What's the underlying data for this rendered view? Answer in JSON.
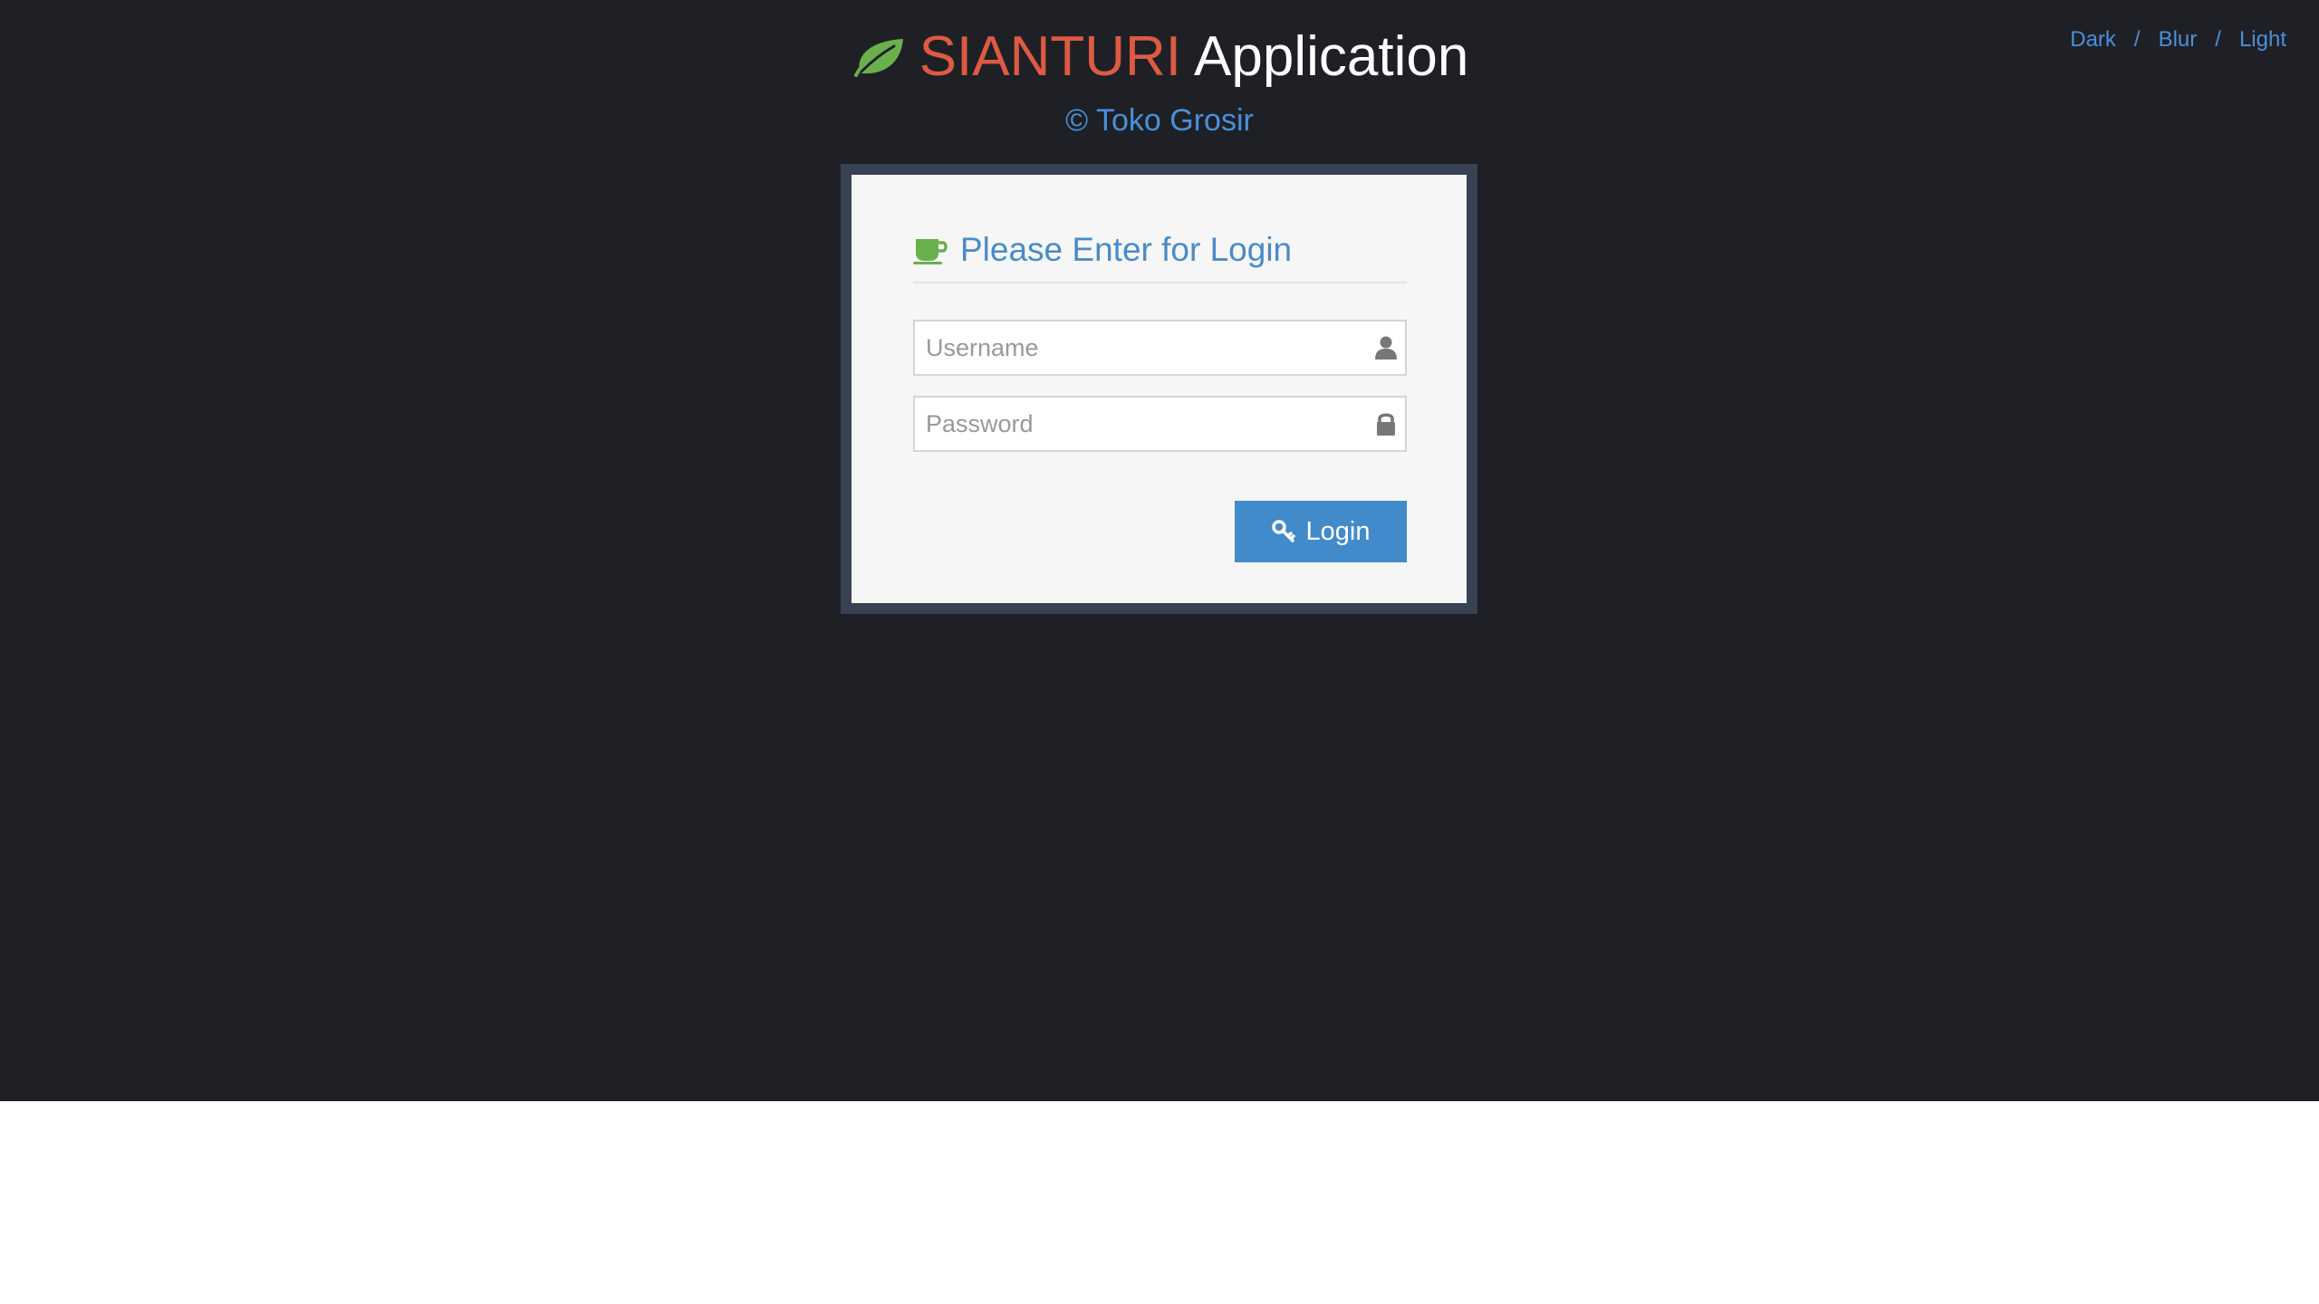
{
  "theme_switch": {
    "items": [
      "Dark",
      "Blur",
      "Light"
    ],
    "separator": "/"
  },
  "brand": {
    "name": "SIANTURI",
    "app_word": "Application",
    "subtitle": "© Toko Grosir",
    "logo_icon": "leaf-icon",
    "name_color": "#dd5a43",
    "logo_color": "#6ab04c"
  },
  "login": {
    "heading": "Please Enter for Login",
    "heading_icon": "coffee-icon",
    "username_placeholder": "Username",
    "username_icon": "user-icon",
    "password_placeholder": "Password",
    "password_icon": "lock-icon",
    "button_label": "Login",
    "button_icon": "key-icon",
    "accent": "#428bca"
  },
  "colors": {
    "background": "#1e2026",
    "frame": "#394253",
    "link": "#4a90d9"
  }
}
